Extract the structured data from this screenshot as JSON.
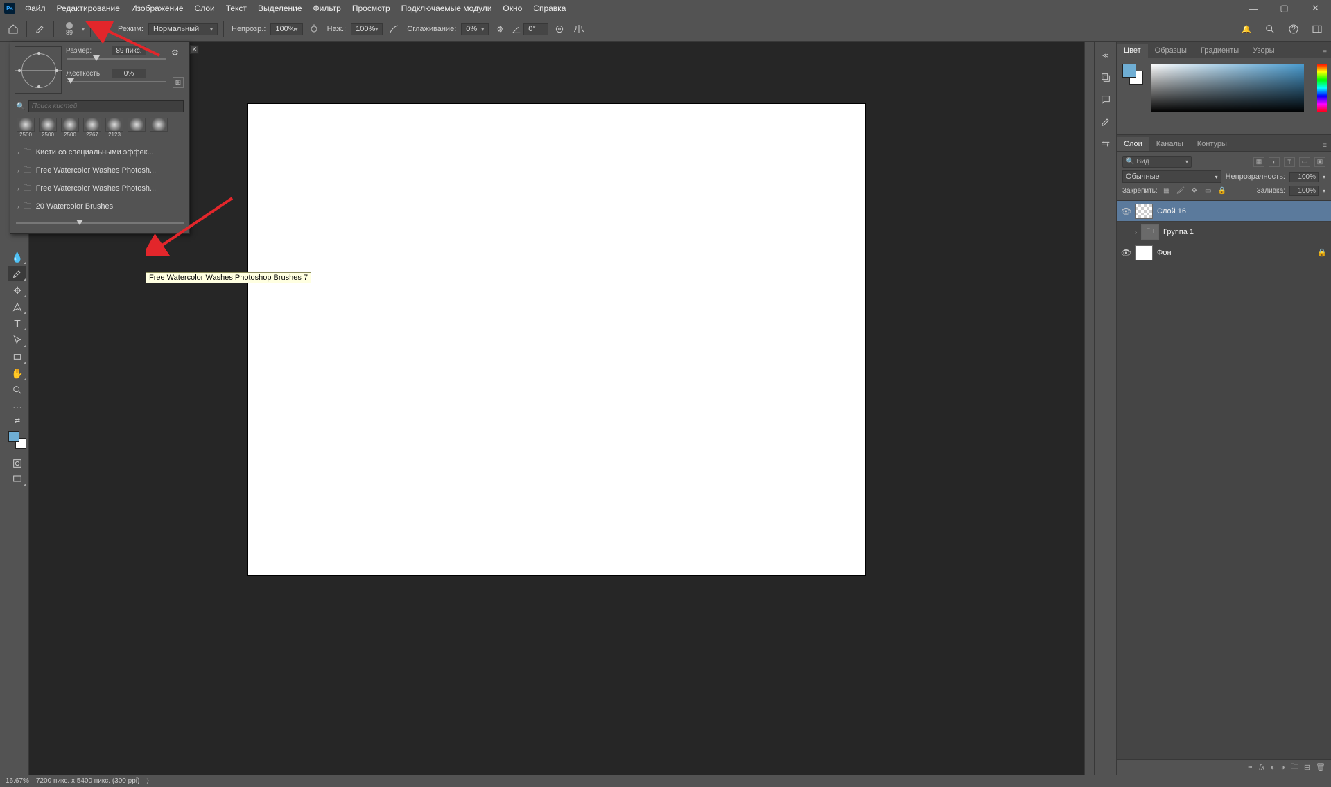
{
  "menu": [
    "Файл",
    "Редактирование",
    "Изображение",
    "Слои",
    "Текст",
    "Выделение",
    "Фильтр",
    "Просмотр",
    "Подключаемые модули",
    "Окно",
    "Справка"
  ],
  "optbar": {
    "brush_size_num": "89",
    "mode_label": "Режим:",
    "mode_value": "Нормальный",
    "opacity_label": "Непрозр.:",
    "opacity_value": "100%",
    "flow_label": "Наж.:",
    "flow_value": "100%",
    "smoothing_label": "Сглаживание:",
    "smoothing_value": "0%",
    "angle_value": "0°"
  },
  "brush_popover": {
    "size_label": "Размер:",
    "size_value": "89 пикс.",
    "hardness_label": "Жесткость:",
    "hardness_value": "0%",
    "search_placeholder": "Поиск кистей",
    "presets": [
      "2500",
      "2500",
      "2500",
      "2267",
      "2123"
    ],
    "folders": [
      "Кисти со специальными эффек...",
      "Free Watercolor Washes Photosh...",
      "Free Watercolor Washes Photosh...",
      "20 Watercolor  Brushes"
    ]
  },
  "tooltip": "Free Watercolor Washes Photoshop Brushes 7",
  "color_panel_tabs": [
    "Цвет",
    "Образцы",
    "Градиенты",
    "Узоры"
  ],
  "layers_panel": {
    "tabs": [
      "Слои",
      "Каналы",
      "Контуры"
    ],
    "search_kind": "Вид",
    "blend_mode": "Обычные",
    "opacity_label": "Непрозрачность:",
    "opacity_value": "100%",
    "lock_label": "Закрепить:",
    "fill_label": "Заливка:",
    "fill_value": "100%",
    "layers": [
      {
        "name": "Слой 16",
        "visible": true,
        "selected": true,
        "type": "trans"
      },
      {
        "name": "Группа 1",
        "visible": false,
        "selected": false,
        "type": "folder"
      },
      {
        "name": "Фон",
        "visible": true,
        "selected": false,
        "type": "white",
        "locked": true
      }
    ]
  },
  "status": {
    "zoom": "16.67%",
    "doc": "7200 пикс. x 5400 пикс. (300 ppi)"
  }
}
